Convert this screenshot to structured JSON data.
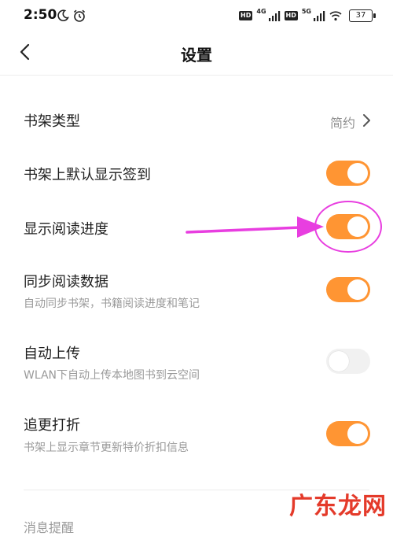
{
  "status_bar": {
    "time": "2:50",
    "net1": "4G",
    "net2": "5G",
    "hd": "HD",
    "battery": "37"
  },
  "nav": {
    "title": "设置",
    "back_icon": "chevron-left-icon"
  },
  "settings": {
    "shelf_type": {
      "label": "书架类型",
      "value": "简约"
    },
    "show_signin": {
      "label": "书架上默认显示签到",
      "enabled": true
    },
    "show_progress": {
      "label": "显示阅读进度",
      "enabled": true
    },
    "sync_data": {
      "label": "同步阅读数据",
      "desc": "自动同步书架，书籍阅读进度和笔记",
      "enabled": true
    },
    "auto_upload": {
      "label": "自动上传",
      "desc": "WLAN下自动上传本地图书到云空间",
      "enabled": false
    },
    "discount": {
      "label": "追更打折",
      "desc": "书架上显示章节更新特价折扣信息",
      "enabled": true
    }
  },
  "partial_section": "消息提醒",
  "watermark": "广东龙网",
  "colors": {
    "toggle_on": "#ff9533",
    "toggle_off": "#f1f1f1",
    "annotation": "#e83ee0",
    "watermark": "#e43a2a"
  }
}
